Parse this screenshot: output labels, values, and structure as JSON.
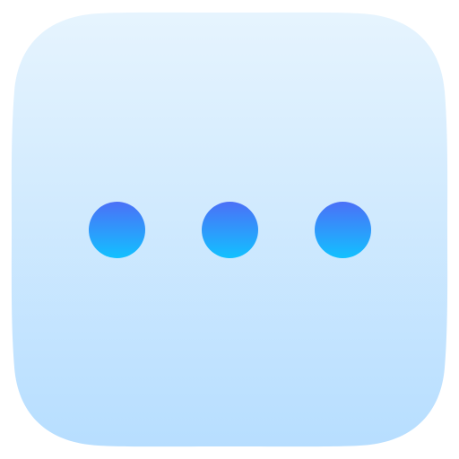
{
  "icon": {
    "name": "more-options-icon",
    "symbol": "ellipsis-horizontal",
    "dot_count": 3,
    "colors": {
      "background_top": "#E6F4FE",
      "background_bottom": "#B7DEFF",
      "dot_top": "#4B70F7",
      "dot_bottom": "#12C1FF"
    }
  }
}
